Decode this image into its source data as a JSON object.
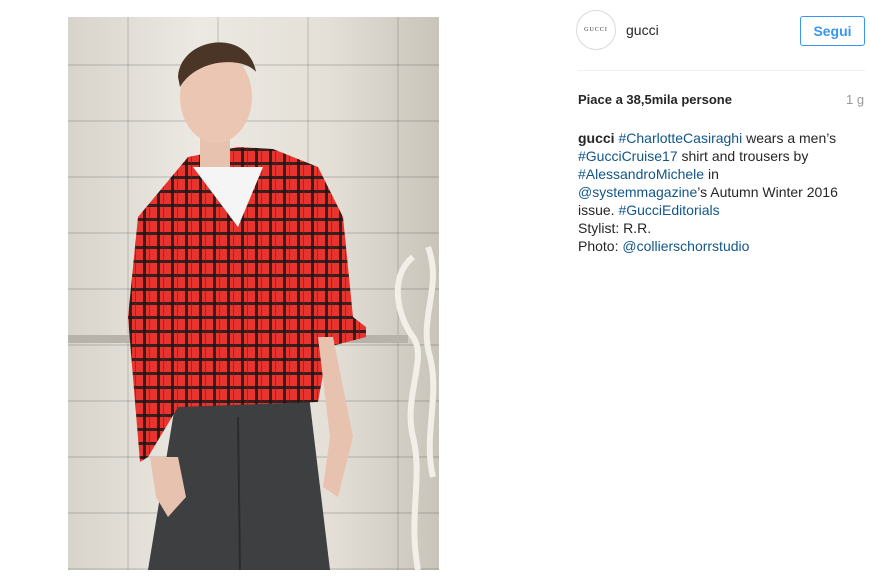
{
  "post": {
    "image_alt": "Model wearing red plaid shirt and grey jeans leaning against a brick wall"
  },
  "header": {
    "avatar_text": "GUCCI",
    "username": "gucci",
    "follow_label": "Segui"
  },
  "stats": {
    "likes": "Piace a 38,5mila persone",
    "time": "1 g"
  },
  "caption": {
    "username": "gucci",
    "line1_tag": "#CharlotteCasiraghi",
    "line1_text": " wears a men’s",
    "line2_tag": "#GucciCruise17",
    "line2_text": " shirt and trousers by",
    "line3_tag": "#AlessandroMichele",
    "line3_text": " in",
    "line4_tag": "@systemmagazine",
    "line4_text": "’s Autumn Winter 2016",
    "line5_text": "issue. ",
    "line5_tag": "#GucciEditorials",
    "line6_text": "Stylist: R.R.",
    "line7_text": "Photo: ",
    "line7_tag": "@collierschorrstudio"
  },
  "colors": {
    "link": "#125688",
    "follow": "#3897f0",
    "shirt": "#e8342f"
  }
}
